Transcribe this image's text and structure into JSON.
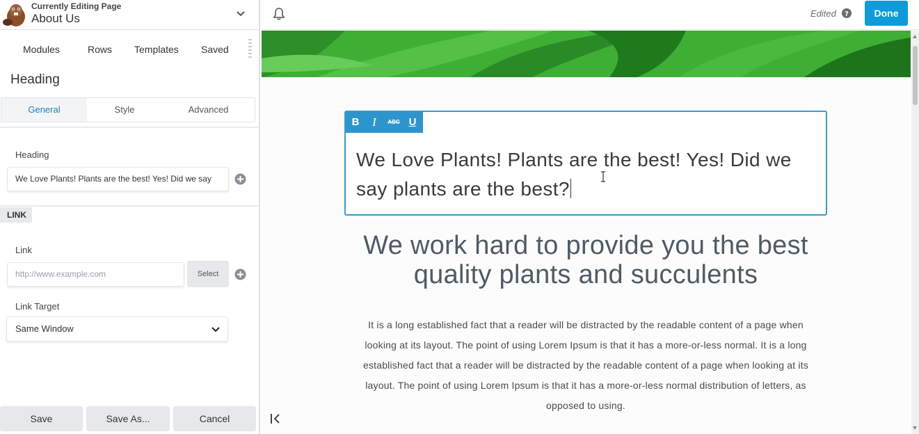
{
  "header": {
    "editing_label": "Currently Editing Page",
    "page_name": "About Us"
  },
  "main_tabs": [
    {
      "label": "Modules"
    },
    {
      "label": "Rows"
    },
    {
      "label": "Templates"
    },
    {
      "label": "Saved"
    }
  ],
  "section_title": "Heading",
  "sub_tabs": [
    {
      "label": "General",
      "active": true
    },
    {
      "label": "Style",
      "active": false
    },
    {
      "label": "Advanced",
      "active": false
    }
  ],
  "fields": {
    "heading_label": "Heading",
    "heading_value": "We Love Plants! Plants are the best! Yes! Did we say",
    "link_section": "LINK",
    "link_label": "Link",
    "link_placeholder": "http://www.example.com",
    "select_button": "Select",
    "link_target_label": "Link Target",
    "link_target_value": "Same Window"
  },
  "footer": {
    "save": "Save",
    "save_as": "Save As...",
    "cancel": "Cancel"
  },
  "topbar": {
    "status": "Edited",
    "done": "Done"
  },
  "format_toolbar": {
    "bold": "B",
    "italic": "I",
    "strike": "ABC",
    "underline": "U"
  },
  "content": {
    "heading": "We Love Plants! Plants are the best! Yes! Did we say plants are the best?",
    "subheading": "We work hard to provide you the best quality plants and succulents",
    "paragraph": "It is a long established fact that a reader will be distracted by the readable content of a page when looking at its layout. The point of using Lorem Ipsum is that it has a more-or-less normal. It is a long established fact that a reader will be distracted by the readable content of a page when looking at its layout. The point of using Lorem Ipsum is that it has a more-or-less normal distribution of letters, as opposed to using."
  },
  "colors": {
    "accent": "#0e9bd8",
    "active_tab": "#1d80b6",
    "editor_border": "#3a99c9",
    "hero_green": "#3fae35"
  }
}
